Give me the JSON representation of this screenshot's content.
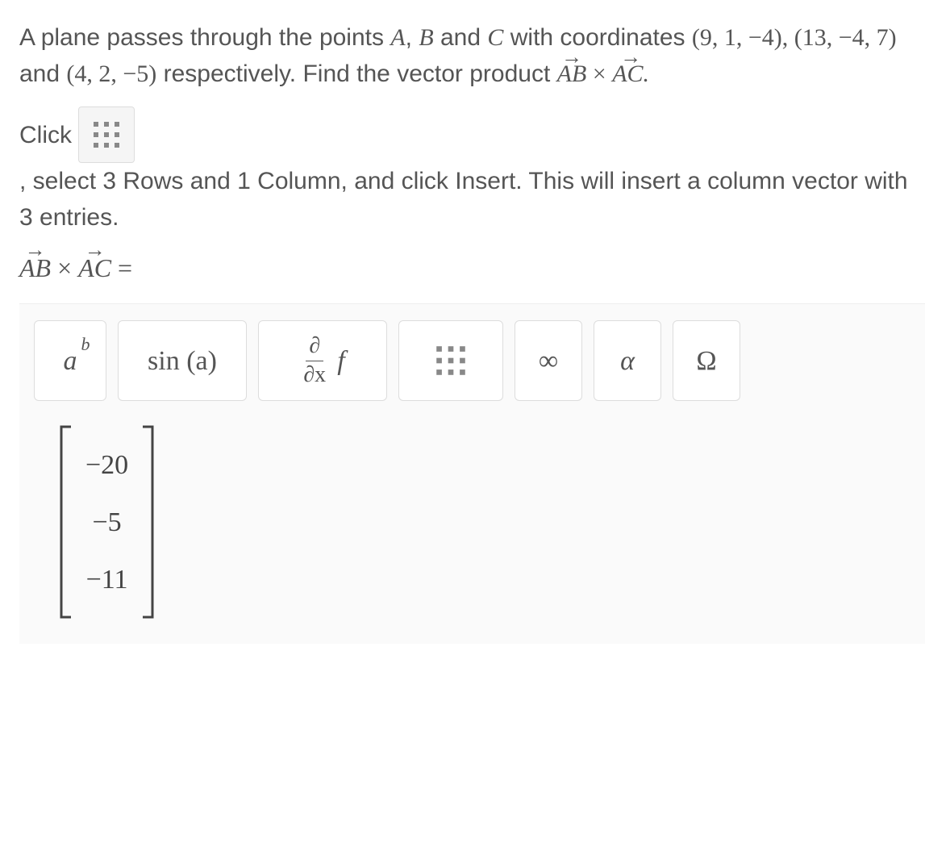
{
  "question": {
    "pre1": "A plane passes through the points ",
    "Alabel": "A",
    "comma1": ", ",
    "Blabel": "B",
    "and_word": " and ",
    "Clabel": "C",
    "post1": " with coordinates ",
    "coords1": "(9, 1, −4)",
    "sep1": ", ",
    "coords2": "(13, −4, 7)",
    "and2": " and ",
    "coords3": "(4, 2, −5)",
    "post2": " respectively. Find the vector product ",
    "vecAB": "AB",
    "times": " × ",
    "vecAC": "AC.",
    "instr_click": "Click ",
    "instr_after": ", select 3 Rows and 1 Column, and click Insert. This will insert a column vector with 3 entries.",
    "eq_vecAB": "AB",
    "eq_times": " × ",
    "eq_vecAC": "AC",
    "eq_equals": " ="
  },
  "toolbar": {
    "power_base": "a",
    "power_exp": "b",
    "trig": "sin (a)",
    "deriv_top": "∂",
    "deriv_bot": "∂x",
    "deriv_f": "f",
    "infinity": "∞",
    "alpha": "α",
    "omega": "Ω"
  },
  "answer": {
    "v1": "−20",
    "v2": "−5",
    "v3": "−11"
  }
}
